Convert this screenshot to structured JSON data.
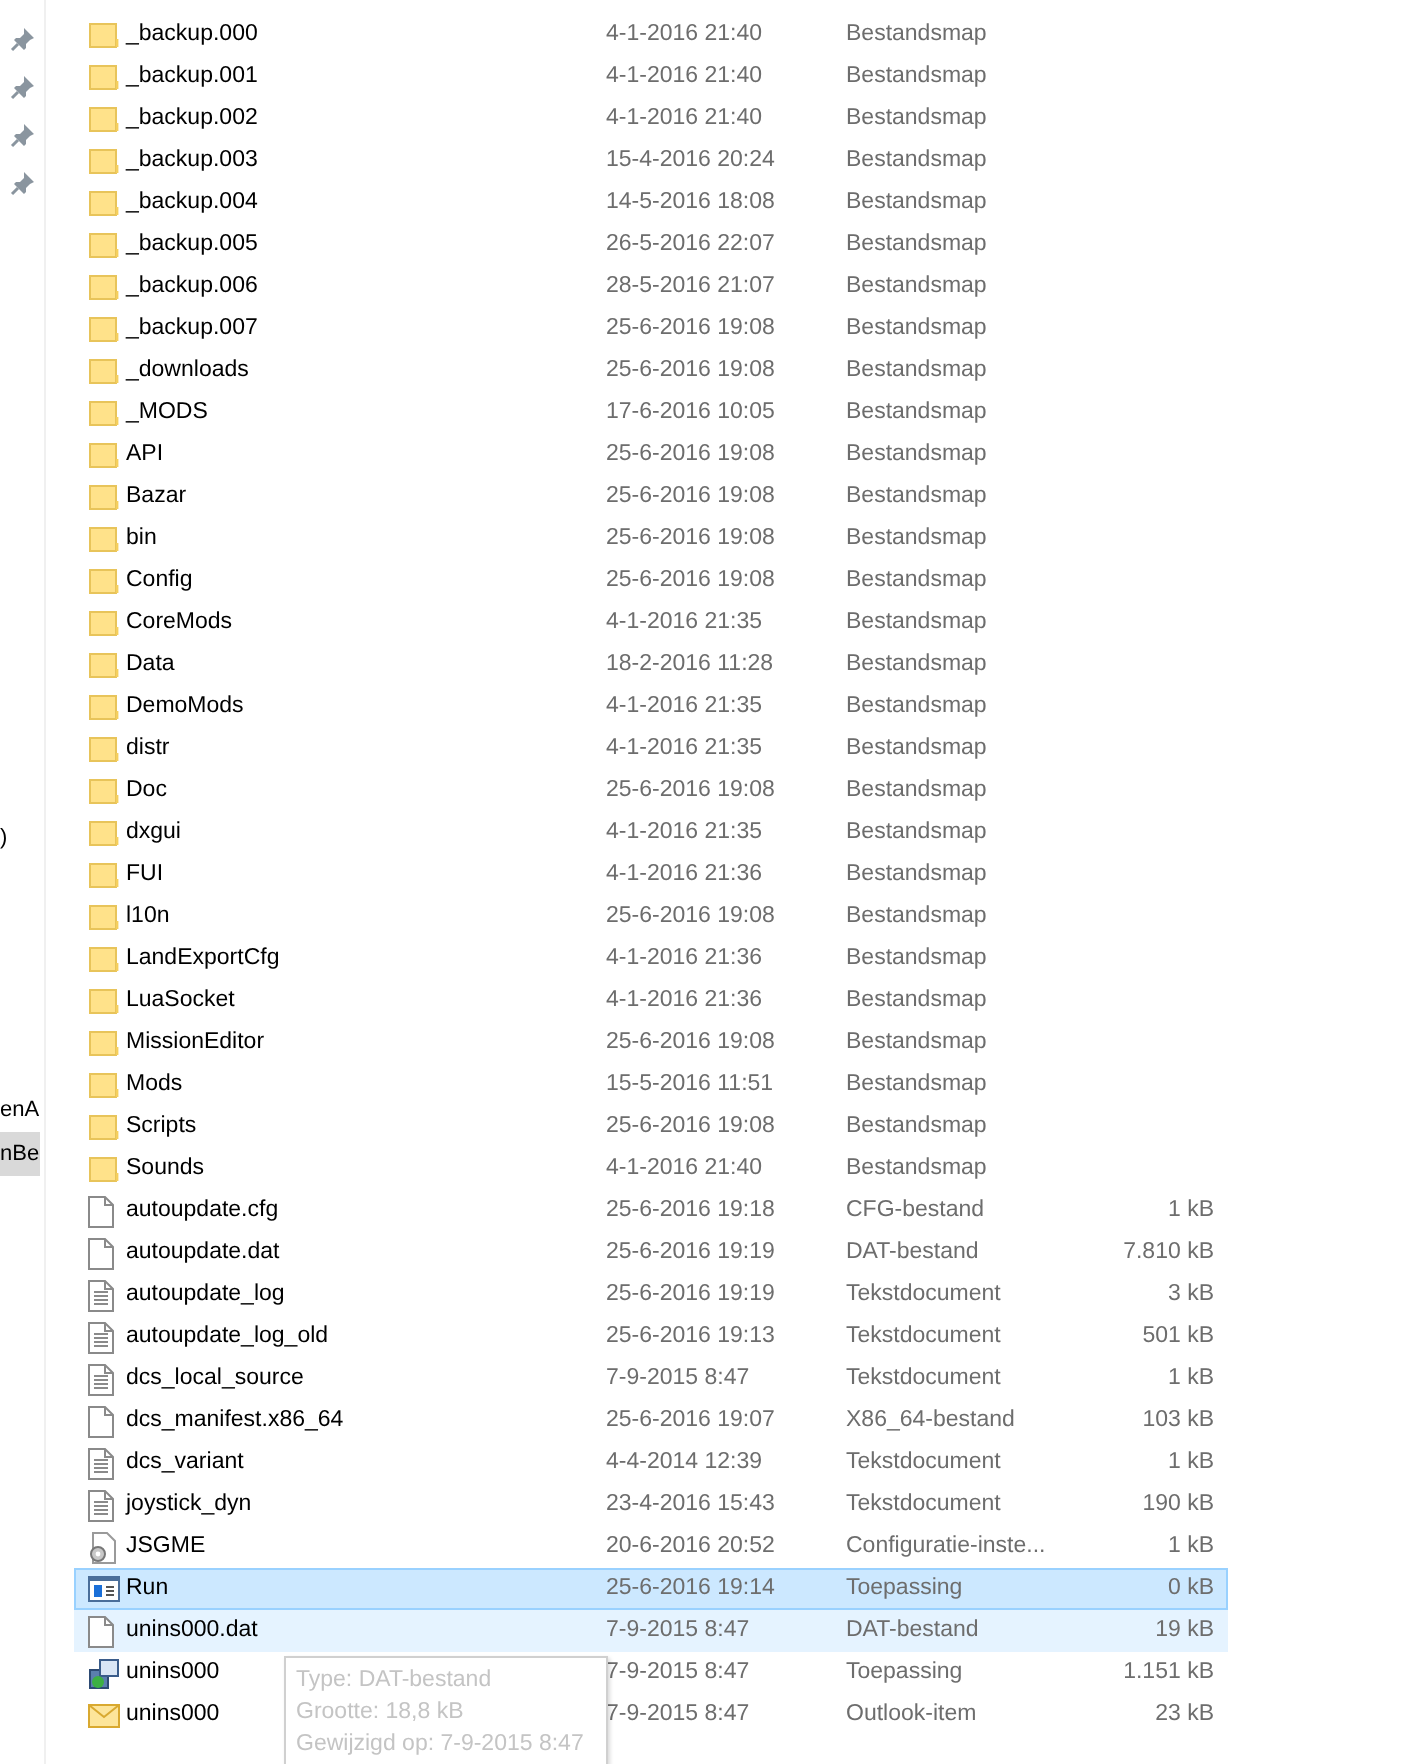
{
  "navigation_pane": {
    "items": [
      {
        "label": ")",
        "selected": false
      },
      {
        "label": "enA",
        "selected": false
      },
      {
        "label": "nBe",
        "selected": true
      }
    ]
  },
  "files": [
    {
      "name": "_backup.000",
      "date": "4-1-2016 21:40",
      "type": "Bestandsmap",
      "kind": "folder",
      "selected": false,
      "hovered": false
    },
    {
      "name": "_backup.001",
      "date": "4-1-2016 21:40",
      "type": "Bestandsmap",
      "kind": "folder",
      "selected": false,
      "hovered": false
    },
    {
      "name": "_backup.002",
      "date": "4-1-2016 21:40",
      "type": "Bestandsmap",
      "kind": "folder",
      "selected": false,
      "hovered": false
    },
    {
      "name": "_backup.003",
      "date": "15-4-2016 20:24",
      "type": "Bestandsmap",
      "kind": "folder",
      "selected": false,
      "hovered": false
    },
    {
      "name": "_backup.004",
      "date": "14-5-2016 18:08",
      "type": "Bestandsmap",
      "kind": "folder",
      "selected": false,
      "hovered": false
    },
    {
      "name": "_backup.005",
      "date": "26-5-2016 22:07",
      "type": "Bestandsmap",
      "kind": "folder",
      "selected": false,
      "hovered": false
    },
    {
      "name": "_backup.006",
      "date": "28-5-2016 21:07",
      "type": "Bestandsmap",
      "kind": "folder",
      "selected": false,
      "hovered": false
    },
    {
      "name": "_backup.007",
      "date": "25-6-2016 19:08",
      "type": "Bestandsmap",
      "kind": "folder",
      "selected": false,
      "hovered": false
    },
    {
      "name": "_downloads",
      "date": "25-6-2016 19:08",
      "type": "Bestandsmap",
      "kind": "folder",
      "selected": false,
      "hovered": false
    },
    {
      "name": "_MODS",
      "date": "17-6-2016 10:05",
      "type": "Bestandsmap",
      "kind": "folder",
      "selected": false,
      "hovered": false
    },
    {
      "name": "API",
      "date": "25-6-2016 19:08",
      "type": "Bestandsmap",
      "kind": "folder",
      "selected": false,
      "hovered": false
    },
    {
      "name": "Bazar",
      "date": "25-6-2016 19:08",
      "type": "Bestandsmap",
      "kind": "folder",
      "selected": false,
      "hovered": false
    },
    {
      "name": "bin",
      "date": "25-6-2016 19:08",
      "type": "Bestandsmap",
      "kind": "folder",
      "selected": false,
      "hovered": false
    },
    {
      "name": "Config",
      "date": "25-6-2016 19:08",
      "type": "Bestandsmap",
      "kind": "folder",
      "selected": false,
      "hovered": false
    },
    {
      "name": "CoreMods",
      "date": "4-1-2016 21:35",
      "type": "Bestandsmap",
      "kind": "folder",
      "selected": false,
      "hovered": false
    },
    {
      "name": "Data",
      "date": "18-2-2016 11:28",
      "type": "Bestandsmap",
      "kind": "folder",
      "selected": false,
      "hovered": false
    },
    {
      "name": "DemoMods",
      "date": "4-1-2016 21:35",
      "type": "Bestandsmap",
      "kind": "folder",
      "selected": false,
      "hovered": false
    },
    {
      "name": "distr",
      "date": "4-1-2016 21:35",
      "type": "Bestandsmap",
      "kind": "folder",
      "selected": false,
      "hovered": false
    },
    {
      "name": "Doc",
      "date": "25-6-2016 19:08",
      "type": "Bestandsmap",
      "kind": "folder",
      "selected": false,
      "hovered": false
    },
    {
      "name": "dxgui",
      "date": "4-1-2016 21:35",
      "type": "Bestandsmap",
      "kind": "folder",
      "selected": false,
      "hovered": false
    },
    {
      "name": "FUI",
      "date": "4-1-2016 21:36",
      "type": "Bestandsmap",
      "kind": "folder",
      "selected": false,
      "hovered": false
    },
    {
      "name": "l10n",
      "date": "25-6-2016 19:08",
      "type": "Bestandsmap",
      "kind": "folder",
      "selected": false,
      "hovered": false
    },
    {
      "name": "LandExportCfg",
      "date": "4-1-2016 21:36",
      "type": "Bestandsmap",
      "kind": "folder",
      "selected": false,
      "hovered": false
    },
    {
      "name": "LuaSocket",
      "date": "4-1-2016 21:36",
      "type": "Bestandsmap",
      "kind": "folder",
      "selected": false,
      "hovered": false
    },
    {
      "name": "MissionEditor",
      "date": "25-6-2016 19:08",
      "type": "Bestandsmap",
      "kind": "folder",
      "selected": false,
      "hovered": false
    },
    {
      "name": "Mods",
      "date": "15-5-2016 11:51",
      "type": "Bestandsmap",
      "kind": "folder",
      "selected": false,
      "hovered": false
    },
    {
      "name": "Scripts",
      "date": "25-6-2016 19:08",
      "type": "Bestandsmap",
      "kind": "folder",
      "selected": false,
      "hovered": false
    },
    {
      "name": "Sounds",
      "date": "4-1-2016 21:40",
      "type": "Bestandsmap",
      "kind": "folder",
      "selected": false,
      "hovered": false
    },
    {
      "name": "autoupdate.cfg",
      "date": "25-6-2016 19:18",
      "type": "CFG-bestand",
      "size": "1 kB",
      "kind": "file",
      "selected": false,
      "hovered": false
    },
    {
      "name": "autoupdate.dat",
      "date": "25-6-2016 19:19",
      "type": "DAT-bestand",
      "size": "7.810 kB",
      "kind": "file",
      "selected": false,
      "hovered": false
    },
    {
      "name": "autoupdate_log",
      "date": "25-6-2016 19:19",
      "type": "Tekstdocument",
      "size": "3 kB",
      "kind": "text",
      "selected": false,
      "hovered": false
    },
    {
      "name": "autoupdate_log_old",
      "date": "25-6-2016 19:13",
      "type": "Tekstdocument",
      "size": "501 kB",
      "kind": "text",
      "selected": false,
      "hovered": false
    },
    {
      "name": "dcs_local_source",
      "date": "7-9-2015 8:47",
      "type": "Tekstdocument",
      "size": "1 kB",
      "kind": "text",
      "selected": false,
      "hovered": false
    },
    {
      "name": "dcs_manifest.x86_64",
      "date": "25-6-2016 19:07",
      "type": "X86_64-bestand",
      "size": "103 kB",
      "kind": "file",
      "selected": false,
      "hovered": false
    },
    {
      "name": "dcs_variant",
      "date": "4-4-2014 12:39",
      "type": "Tekstdocument",
      "size": "1 kB",
      "kind": "text",
      "selected": false,
      "hovered": false
    },
    {
      "name": "joystick_dyn",
      "date": "23-4-2016 15:43",
      "type": "Tekstdocument",
      "size": "190 kB",
      "kind": "text",
      "selected": false,
      "hovered": false
    },
    {
      "name": "JSGME",
      "date": "20-6-2016 20:52",
      "type": "Configuratie-inste...",
      "size": "1 kB",
      "kind": "config",
      "selected": false,
      "hovered": false
    },
    {
      "name": "Run",
      "date": "25-6-2016 19:14",
      "type": "Toepassing",
      "size": "0 kB",
      "kind": "app",
      "selected": true,
      "hovered": false
    },
    {
      "name": "unins000.dat",
      "date": "7-9-2015 8:47",
      "type": "DAT-bestand",
      "size": "19 kB",
      "kind": "file",
      "selected": false,
      "hovered": true
    },
    {
      "name": "unins000",
      "date": "7-9-2015 8:47",
      "type": "Toepassing",
      "size": "1.151 kB",
      "kind": "installer",
      "selected": false,
      "hovered": false
    },
    {
      "name": "unins000",
      "date": "7-9-2015 8:47",
      "type": "Outlook-item",
      "size": "23 kB",
      "kind": "mail",
      "selected": false,
      "hovered": false
    }
  ],
  "tooltip": {
    "lines": [
      "Type: DAT-bestand",
      "Grootte: 18,8 kB",
      "Gewijzigd op: 7-9-2015 8:47"
    ]
  }
}
